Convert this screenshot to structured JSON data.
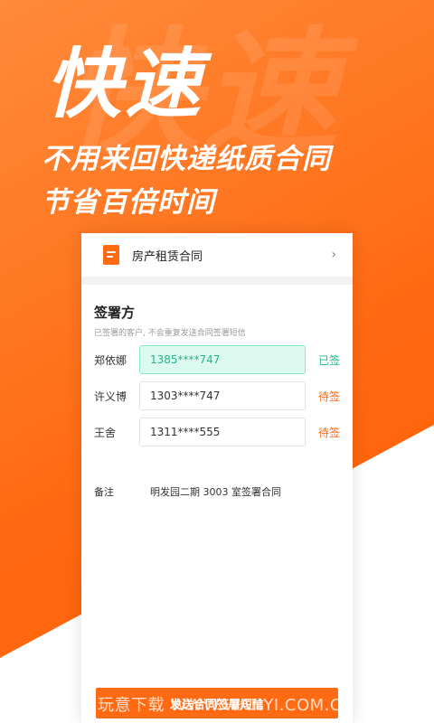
{
  "hero": {
    "watermark": "快速",
    "title": "快速",
    "subtitle_line1": "不用来回快递纸质合同",
    "subtitle_line2": "节省百倍时间"
  },
  "document": {
    "title": "房产租赁合同",
    "icon": "document-icon",
    "chevron": "›"
  },
  "signers_section": {
    "title": "签署方",
    "hint": "已签署的客户, 不会重复发送合同签署短信",
    "signers": [
      {
        "name": "郑依娜",
        "phone": "1385****747",
        "status": "已签"
      },
      {
        "name": "许义博",
        "phone": "1303****747",
        "status": "待签"
      },
      {
        "name": "王舍",
        "phone": "1311****555",
        "status": "待签"
      }
    ]
  },
  "note": {
    "label": "备注",
    "value": "明发园二期 3003 室签署合同"
  },
  "actions": {
    "submit_label": "发送合同签署短信"
  },
  "watermark": {
    "text": "玩意下载 WWW.WANYI.COM.CN"
  },
  "colors": {
    "brand_orange": "#ff6a12",
    "signed_green": "#21b889"
  }
}
